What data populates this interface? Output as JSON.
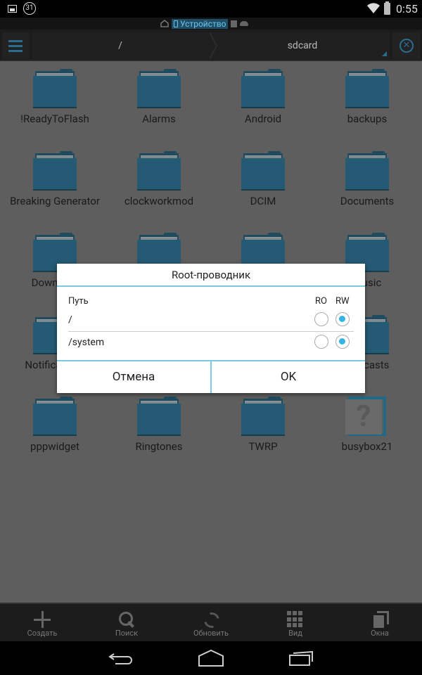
{
  "status_bar": {
    "left_icons": [
      "image-notification-icon",
      "calendar-icon"
    ],
    "calendar_day": "31",
    "time": "0:55",
    "right_icons": [
      "wifi-icon",
      "battery-charging-icon"
    ]
  },
  "location_bar": {
    "items": [
      {
        "icon": "home-icon",
        "label": ""
      },
      {
        "icon": "phone-icon",
        "label": "Устройство",
        "active": true
      },
      {
        "icon": "computer-icon",
        "label": ""
      },
      {
        "icon": "cloud-icon",
        "label": ""
      }
    ],
    "active_color": "#33b5e5"
  },
  "toolbar": {
    "menu_icon": "hamburger-menu-icon",
    "breadcrumbs": [
      "/",
      "sdcard"
    ],
    "close_icon": "close-circle-icon",
    "close_glyph": "✕"
  },
  "files": [
    {
      "name": "!ReadyToFlash",
      "type": "folder"
    },
    {
      "name": "Alarms",
      "type": "folder"
    },
    {
      "name": "Android",
      "type": "folder"
    },
    {
      "name": "backups",
      "type": "folder"
    },
    {
      "name": "Breaking Generator",
      "type": "folder"
    },
    {
      "name": "clockworkmod",
      "type": "folder"
    },
    {
      "name": "DCIM",
      "type": "folder"
    },
    {
      "name": "Documents",
      "type": "folder"
    },
    {
      "name": "Download",
      "type": "folder"
    },
    {
      "name": "",
      "type": "folder"
    },
    {
      "name": "",
      "type": "folder"
    },
    {
      "name": "Music",
      "type": "folder"
    },
    {
      "name": "Notifications",
      "type": "folder"
    },
    {
      "name": "",
      "type": "folder"
    },
    {
      "name": "",
      "type": "folder"
    },
    {
      "name": "Podcasts",
      "type": "folder"
    },
    {
      "name": "pppwidget",
      "type": "folder"
    },
    {
      "name": "Ringtones",
      "type": "folder"
    },
    {
      "name": "TWRP",
      "type": "folder"
    },
    {
      "name": "busybox21",
      "type": "unknown"
    }
  ],
  "dialog": {
    "title": "Root-проводник",
    "col_path": "Путь",
    "col_ro": "RO",
    "col_rw": "RW",
    "rows": [
      {
        "path": "/",
        "mode": "RW"
      },
      {
        "path": "/system",
        "mode": "RW"
      }
    ],
    "cancel_label": "Отмена",
    "ok_label": "OK",
    "accent_color": "#33b5e5"
  },
  "action_bar": {
    "items": [
      {
        "label": "Создать",
        "icon": "plus-icon"
      },
      {
        "label": "Поиск",
        "icon": "search-icon"
      },
      {
        "label": "Обновить",
        "icon": "refresh-icon"
      },
      {
        "label": "Вид",
        "icon": "grid-view-icon"
      },
      {
        "label": "Окна",
        "icon": "windows-icon"
      }
    ]
  },
  "nav_bar": {
    "buttons": [
      "back-icon",
      "home-icon",
      "recent-apps-icon"
    ]
  }
}
